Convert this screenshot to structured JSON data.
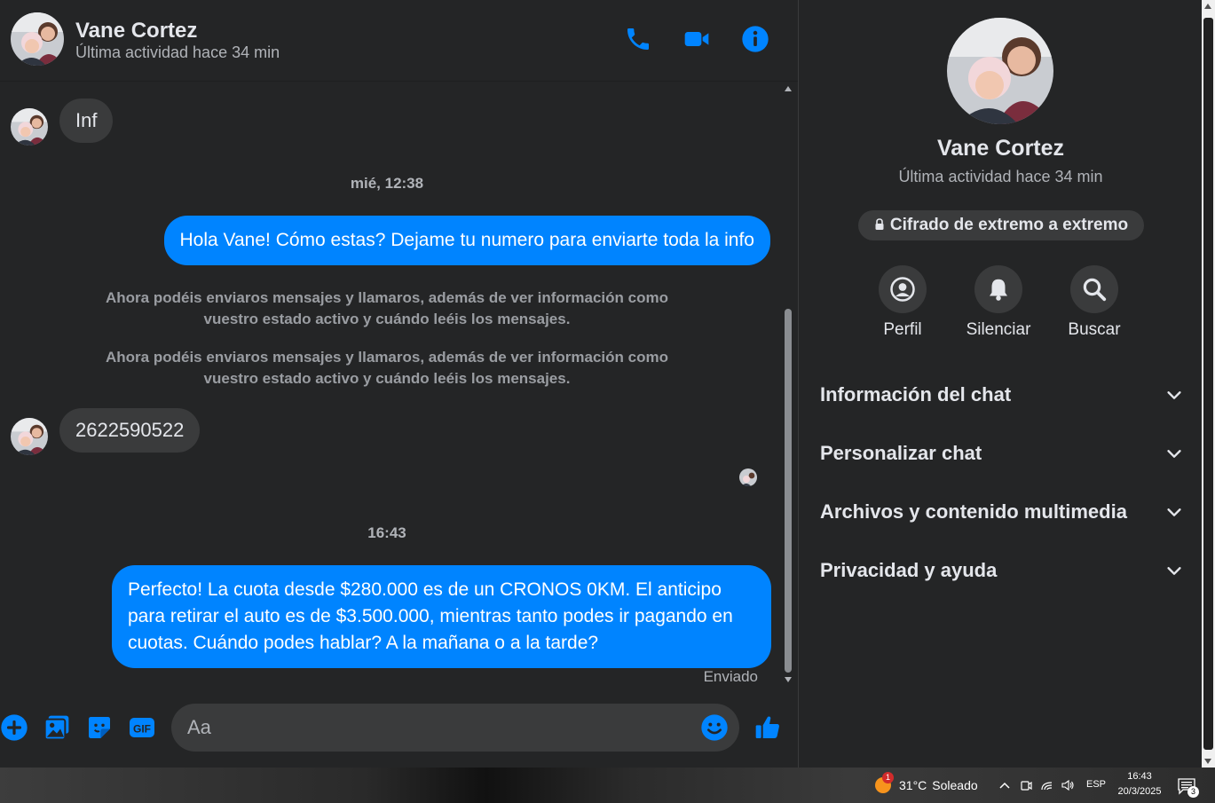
{
  "colors": {
    "accent": "#0084ff",
    "background": "#242526",
    "bubble_incoming": "#3a3b3c",
    "bubble_outgoing": "#0084ff"
  },
  "header": {
    "contact_name": "Vane Cortez",
    "status": "Última actividad hace 34 min",
    "icons": [
      "phone-icon",
      "video-call-icon",
      "info-icon"
    ]
  },
  "messages": {
    "incoming_1": "Inf",
    "timestamp_1": "mié, 12:38",
    "outgoing_1": "Hola Vane! Cómo estas? Dejame tu numero para enviarte toda la info",
    "system_1": "Ahora podéis enviaros mensajes y llamaros, además de ver información como vuestro estado activo y cuándo leéis los mensajes.",
    "system_2": "Ahora podéis enviaros mensajes y llamaros, además de ver información como vuestro estado activo y cuándo leéis los mensajes.",
    "incoming_2": "2622590522",
    "timestamp_2": "16:43",
    "outgoing_2": "Perfecto! La cuota desde $280.000 es de un CRONOS 0KM. El anticipo para retirar el auto es de $3.500.000, mientras tanto podes ir pagando en cuotas. Cuándo podes hablar? A la mañana o a la tarde?",
    "delivery_status": "Enviado"
  },
  "composer": {
    "placeholder": "Aa",
    "icons": [
      "add-icon",
      "photo-icon",
      "sticker-icon",
      "gif-icon",
      "emoji-icon",
      "thumbs-up-icon"
    ],
    "gif_label": "GIF"
  },
  "info_panel": {
    "name": "Vane Cortez",
    "status": "Última actividad hace 34 min",
    "encryption": "Cifrado de extremo a extremo",
    "actions": [
      {
        "label": "Perfil",
        "icon": "profile-icon"
      },
      {
        "label": "Silenciar",
        "icon": "bell-icon"
      },
      {
        "label": "Buscar",
        "icon": "search-icon"
      }
    ],
    "sections": [
      "Información del chat",
      "Personalizar chat",
      "Archivos y contenido multimedia",
      "Privacidad y ayuda"
    ]
  },
  "taskbar": {
    "weather_badge": "1",
    "temperature": "31°C",
    "weather_desc": "Soleado",
    "language": "ESP",
    "time": "16:43",
    "date": "20/3/2025",
    "notification_count": "3"
  }
}
